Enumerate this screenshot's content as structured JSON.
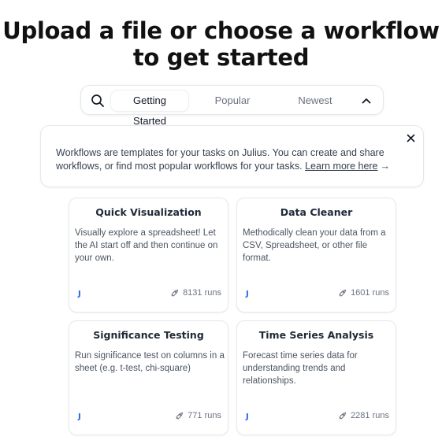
{
  "header": {
    "title_line1": "Upload a file or choose a workflow",
    "title_line2": "to get started"
  },
  "tabs": {
    "items": [
      {
        "label": "Getting Started",
        "active": true
      },
      {
        "label": "Popular",
        "active": false
      },
      {
        "label": "Newest",
        "active": false
      }
    ],
    "icons": {
      "search": "search-icon",
      "collapse": "chevron-up-icon"
    }
  },
  "info_banner": {
    "text": "Workflows are templates for your tasks on Julius. You can create and share workflows, or find most popular workflows for your tasks.",
    "link_label": "Learn more here",
    "arrow": "→",
    "close_icon": "close-icon"
  },
  "workflows": [
    {
      "title": "Quick Visualization",
      "description": "Visually explore a spreadsheet! Let the AI start off and then continue on your own.",
      "author_initial": "J",
      "runs": "8131 runs"
    },
    {
      "title": "Data Cleaner",
      "description": "Methodically clean your data from a CSV, Spreadsheet, or other file format.",
      "author_initial": "J",
      "runs": "1601 runs"
    },
    {
      "title": "Significance Testing",
      "description": "Run significance test on columns in a sheet (e.g. t-test, chi-square)",
      "author_initial": "J",
      "runs": "771 runs"
    },
    {
      "title": "Time Series Analysis",
      "description": "Forecast time series data for understanding trends and relationships.",
      "author_initial": "J",
      "runs": "2281 runs"
    }
  ],
  "colors": {
    "accent": "#2563eb",
    "border": "#e5e7eb",
    "text": "#111827",
    "muted": "#6b7280"
  }
}
